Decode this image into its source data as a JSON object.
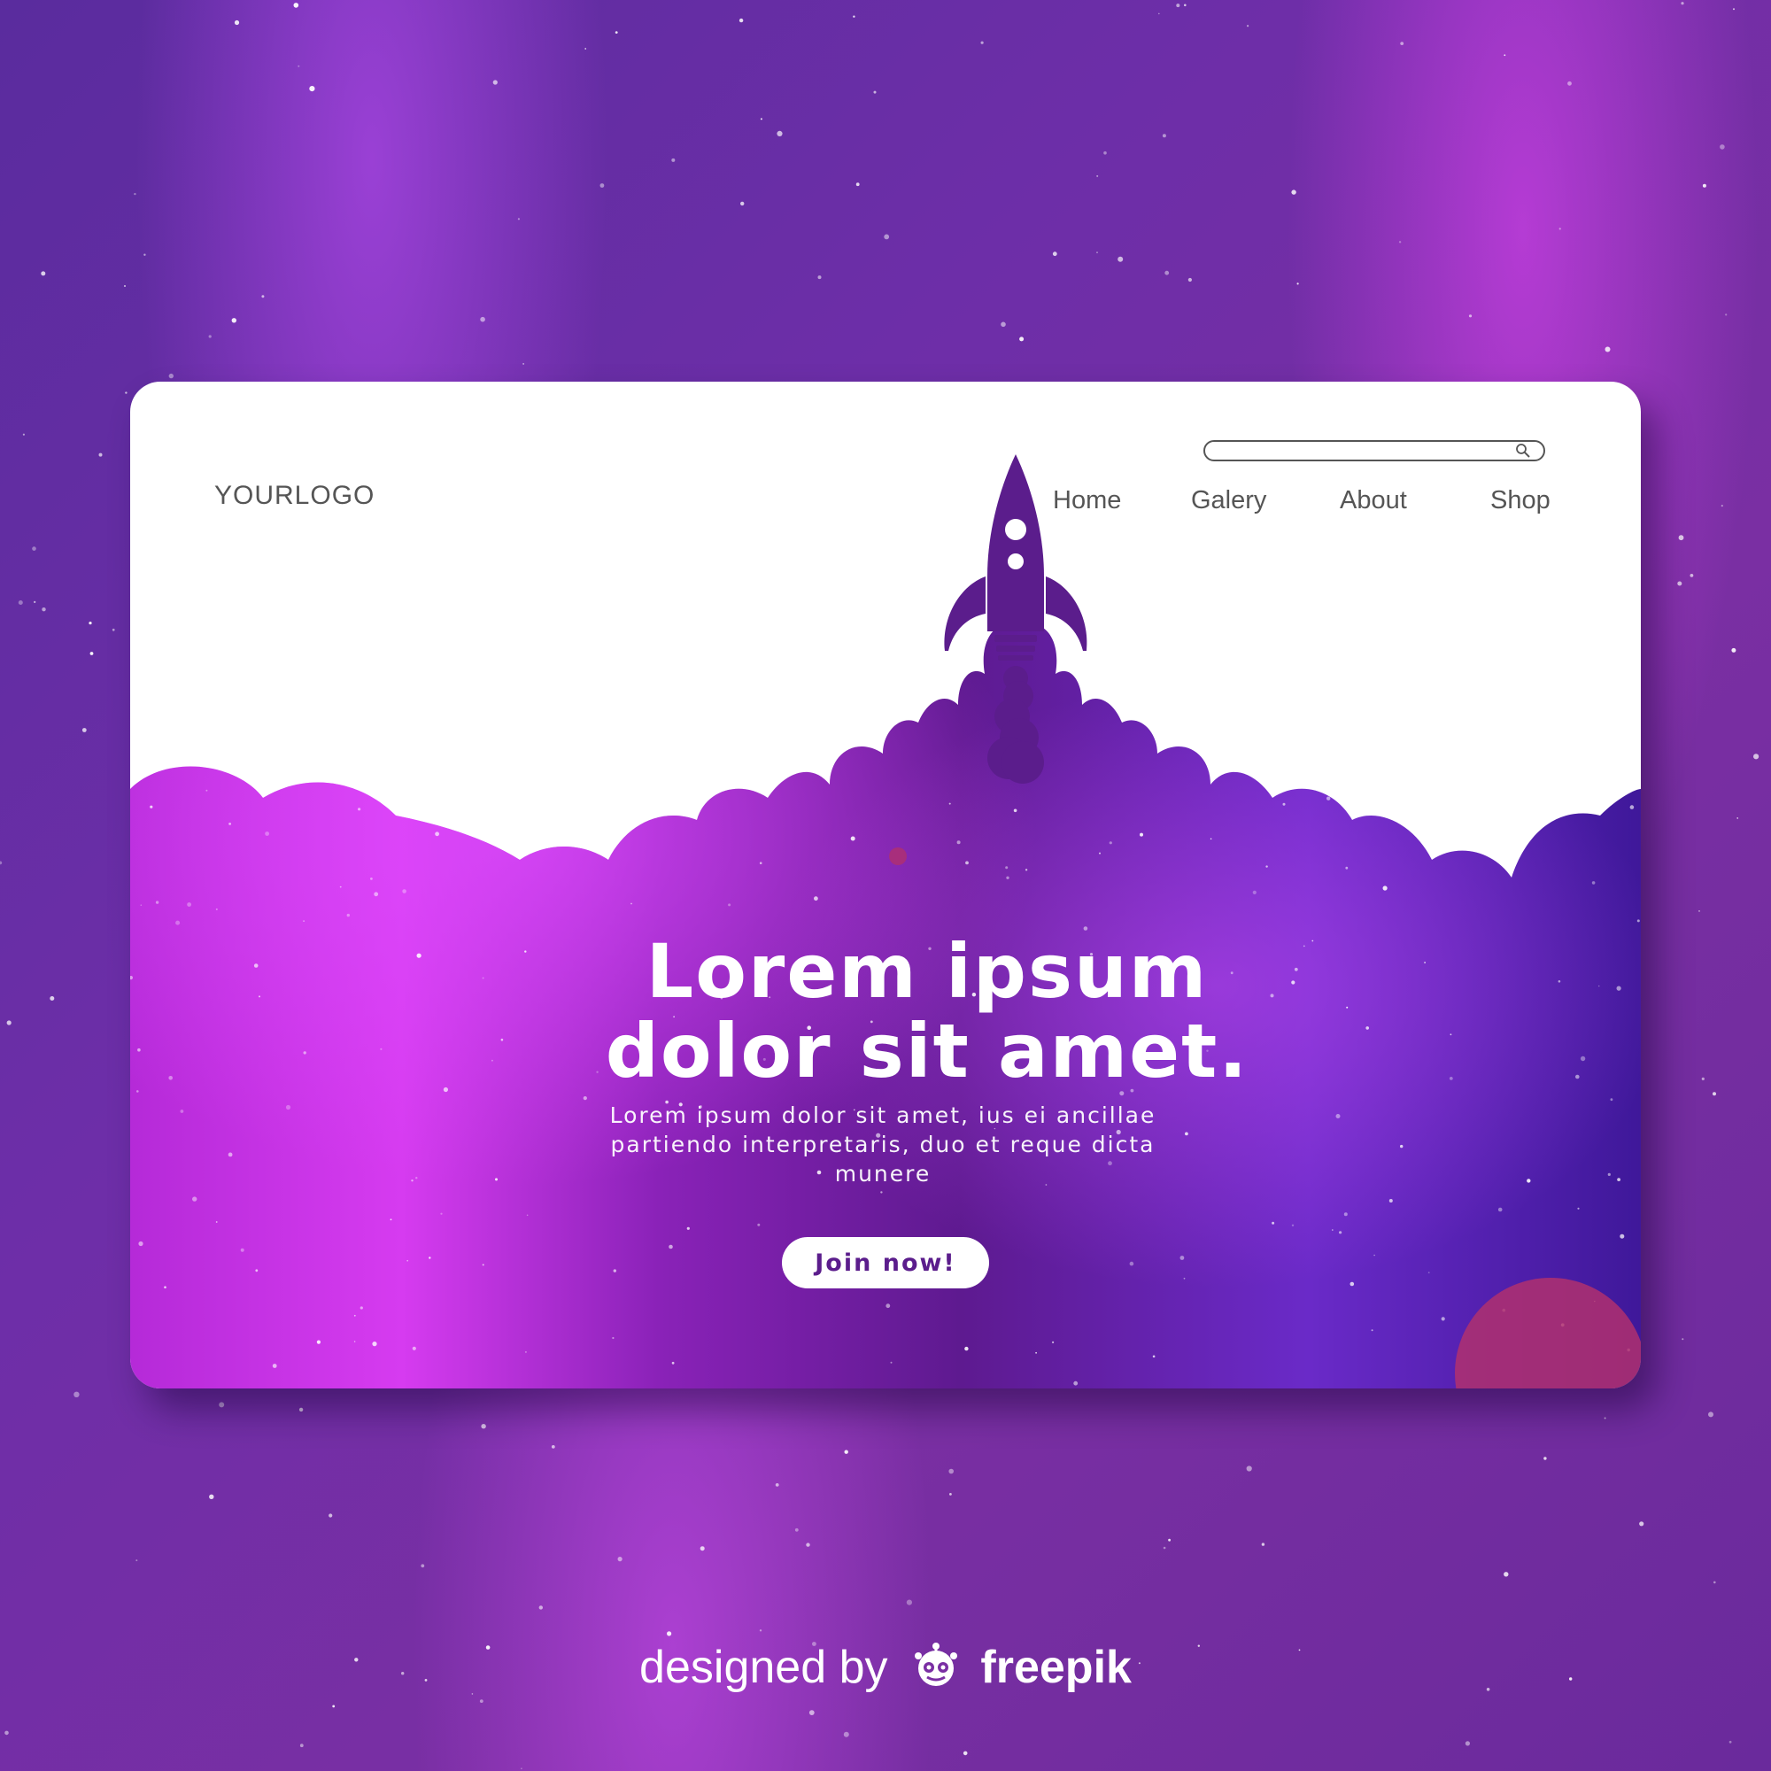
{
  "header": {
    "logo": "YOURLOGO",
    "nav": [
      "Home",
      "Galery",
      "About",
      "Shop"
    ]
  },
  "hero": {
    "title_line1": "Lorem ipsum",
    "title_line2": "dolor sit amet.",
    "body_line1": "Lorem ipsum dolor sit amet, ius ei ancillae",
    "body_line2": "partiendo interpretaris, duo et reque dicta",
    "body_line3": "munere",
    "cta_label": "Join now!"
  },
  "credit": {
    "prefix": "designed by",
    "brand": "freepik"
  },
  "colors": {
    "rocket": "#5b1d8c",
    "cloud_pink": "#d63bf0",
    "cloud_purple": "#6a1d9a",
    "cloud_indigo": "#4a1aa0",
    "planet": "#b0306e"
  },
  "icons": [
    "rocket-icon",
    "search-icon",
    "freepik-logo-icon"
  ]
}
